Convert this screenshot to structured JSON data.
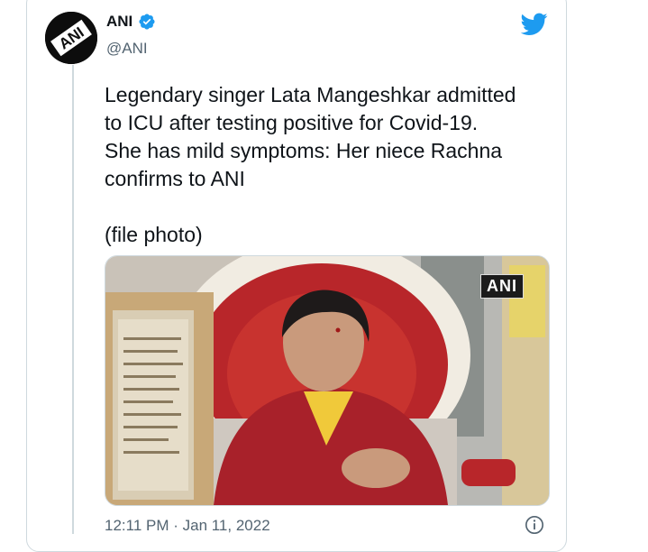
{
  "tweet": {
    "author": {
      "display_name": "ANI",
      "handle": "@ANI",
      "verified": true,
      "avatar_text": "ANI"
    },
    "text": "Legendary singer Lata Mangeshkar admitted\nto ICU after testing positive for Covid-19.\nShe has mild symptoms: Her niece Rachna\nconfirms to ANI\n\n(file photo)",
    "media": {
      "watermark": "ANI"
    },
    "timestamp": "12:11 PM · Jan 11, 2022",
    "icons": {
      "brand": "twitter-bird-icon",
      "verified": "verified-badge-icon",
      "info": "info-icon"
    },
    "colors": {
      "brand_blue": "#1d9bf0",
      "secondary_text": "#536471",
      "border": "#cfd9de"
    }
  }
}
